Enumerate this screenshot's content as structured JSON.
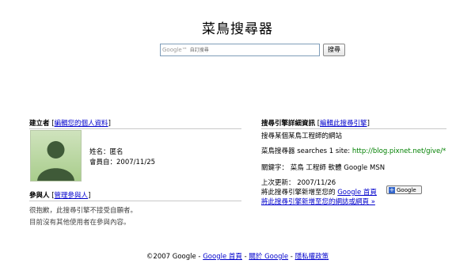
{
  "header": {
    "title": "菜鳥搜尋器",
    "search": {
      "brand": "Google™",
      "placeholder": "自訂搜尋",
      "button_label": "搜尋"
    }
  },
  "creator": {
    "heading": "建立者",
    "edit_link": "編輯您的個人資料",
    "name_label": "姓名：",
    "name_value": "匿名",
    "member_since_label": "會員自：",
    "member_since_value": "2007/11/25"
  },
  "participants": {
    "heading": "參與人",
    "manage_link": "管理參與人",
    "line1": "很抱歉，此搜尋引擎不接受自願者。",
    "line2": "目前沒有其他使用者在參與內容。"
  },
  "engine_details": {
    "heading": "搜尋引擎詳細資訊",
    "edit_link": "編輯此搜尋引擎",
    "description": "搜尋某個某鳥工程師的網站",
    "searches_prefix": "菜鳥搜尋器 searches 1 site: ",
    "searches_site": "http://blog.pixnet.net/give/*",
    "keywords": "關鍵字： 菜鳥 工程師 軟體 Google MSN",
    "last_updated": "上次更新： 2007/11/26",
    "add_to_google_prefix": "將此搜尋引擎新增至您的",
    "add_to_google_link": "Google 首頁",
    "add_to_google_badge": "Google",
    "add_to_site_link": "將此搜尋引擎新增至您的網誌或網頁 »"
  },
  "footer": {
    "copyright": "©2007 Google",
    "sep": " - ",
    "links": [
      "Google 首頁",
      "關於 Google",
      "隱私權政策"
    ]
  },
  "colors": {
    "link": "#0000cc",
    "site_url": "#008000",
    "rule": "#c9c9c9"
  }
}
